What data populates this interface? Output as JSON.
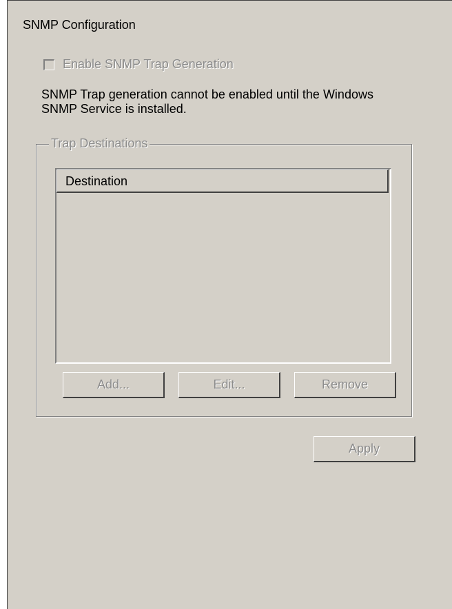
{
  "section": {
    "title": "SNMP Configuration"
  },
  "trap_checkbox": {
    "label": "Enable SNMP Trap Generation",
    "checked": false,
    "enabled": false
  },
  "message": {
    "text": "SNMP Trap generation cannot be enabled until the Windows SNMP Service is installed."
  },
  "trap_destinations": {
    "legend": "Trap Destinations",
    "columns": [
      "Destination"
    ],
    "rows": [],
    "buttons": {
      "add": "Add...",
      "edit": "Edit...",
      "remove": "Remove"
    }
  },
  "apply_button": {
    "label": "Apply"
  }
}
